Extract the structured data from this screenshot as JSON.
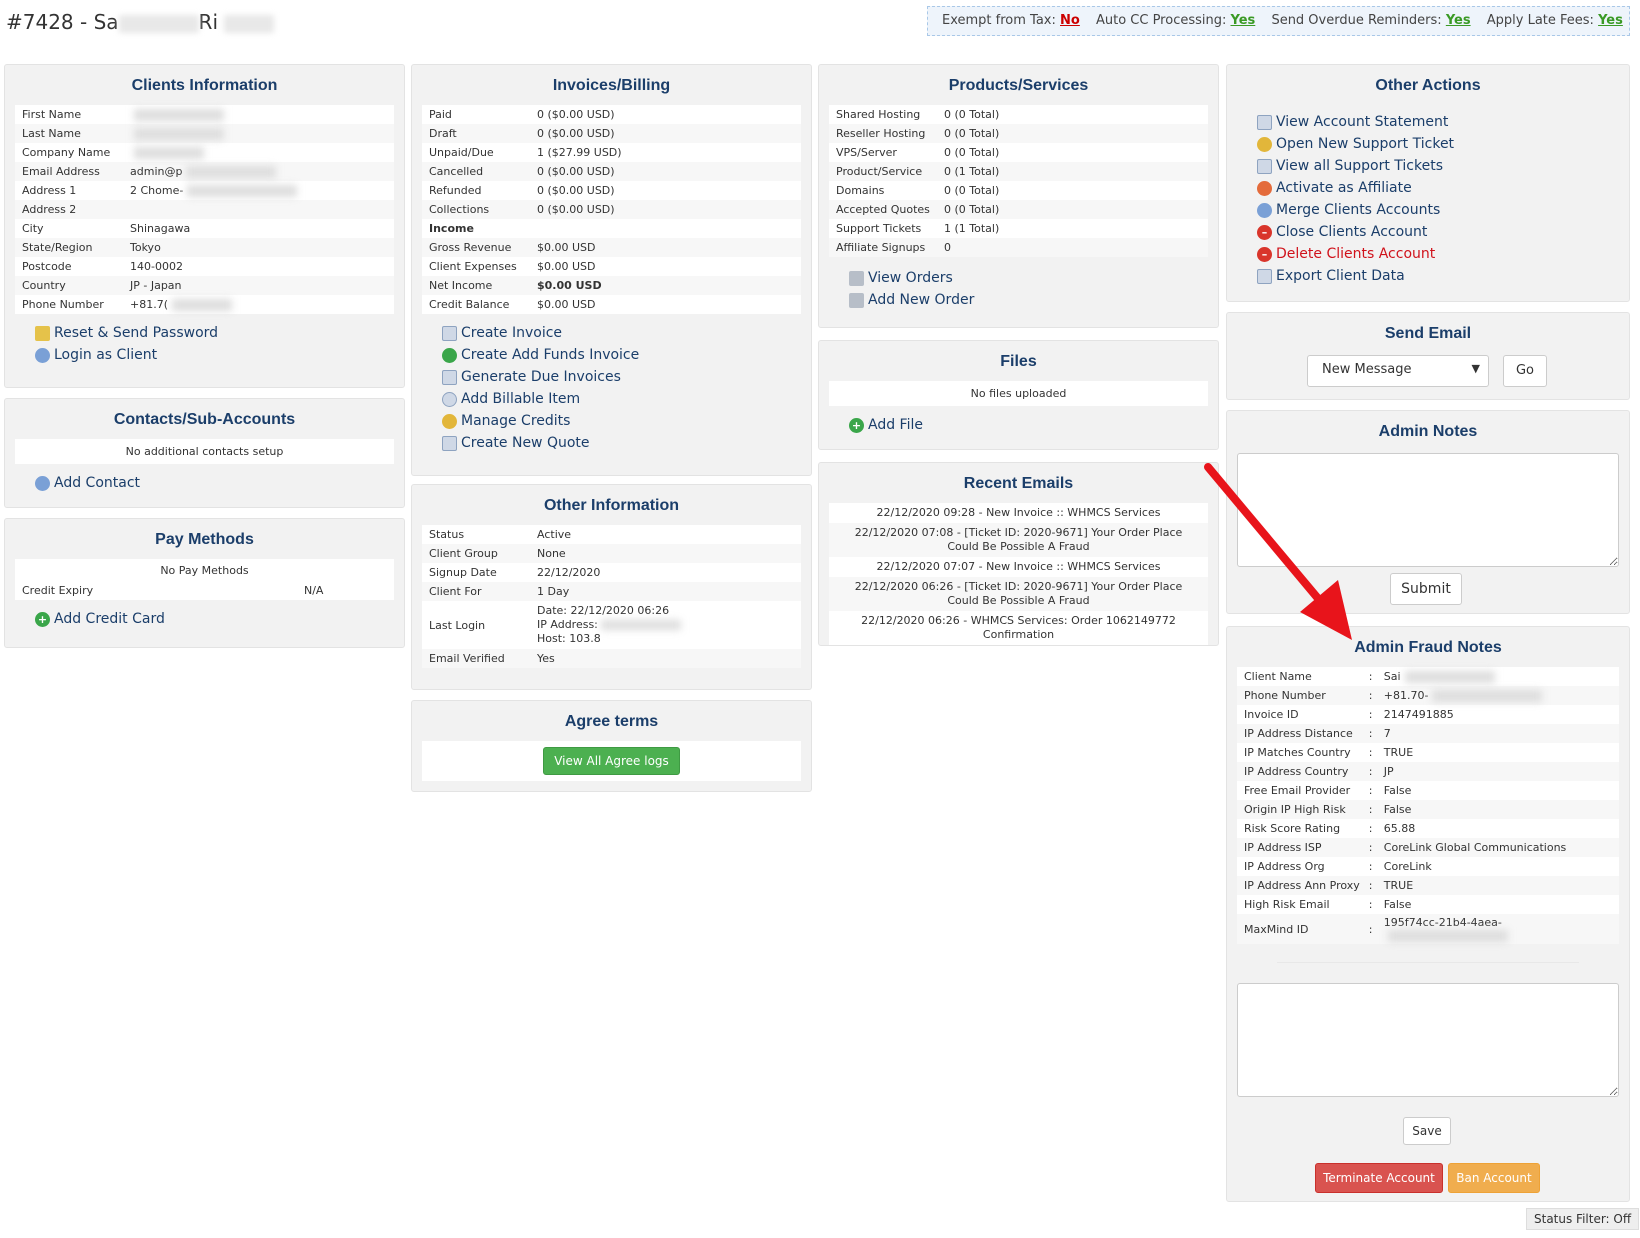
{
  "header": {
    "title_prefix": "#7428 - Sa",
    "title_mid": "Ri"
  },
  "taxbar": {
    "exempt_label": "Exempt from Tax:",
    "exempt_value": "No",
    "autocc_label": "Auto CC Processing:",
    "autocc_value": "Yes",
    "overdue_label": "Send Overdue Reminders:",
    "overdue_value": "Yes",
    "latefee_label": "Apply Late Fees:",
    "latefee_value": "Yes"
  },
  "clients_info": {
    "title": "Clients Information",
    "rows": [
      {
        "k": "First Name",
        "v": ""
      },
      {
        "k": "Last Name",
        "v": ""
      },
      {
        "k": "Company Name",
        "v": ""
      },
      {
        "k": "Email Address",
        "v": "admin@p"
      },
      {
        "k": "Address 1",
        "v": "2 Chome-"
      },
      {
        "k": "Address 2",
        "v": ""
      },
      {
        "k": "City",
        "v": "Shinagawa"
      },
      {
        "k": "State/Region",
        "v": "Tokyo"
      },
      {
        "k": "Postcode",
        "v": "140-0002"
      },
      {
        "k": "Country",
        "v": "JP - Japan"
      },
      {
        "k": "Phone Number",
        "v": "+81.7("
      }
    ],
    "links": [
      "Reset & Send Password",
      "Login as Client"
    ]
  },
  "contacts": {
    "title": "Contacts/Sub-Accounts",
    "note": "No additional contacts setup",
    "link": "Add Contact"
  },
  "paymethods": {
    "title": "Pay Methods",
    "note": "No Pay Methods",
    "expiry_label": "Credit Expiry",
    "expiry_value": "N/A",
    "link": "Add Credit Card"
  },
  "invoices": {
    "title": "Invoices/Billing",
    "rows": [
      {
        "k": "Paid",
        "v": "0 ($0.00 USD)"
      },
      {
        "k": "Draft",
        "v": "0 ($0.00 USD)"
      },
      {
        "k": "Unpaid/Due",
        "v": "1 ($27.99 USD)"
      },
      {
        "k": "Cancelled",
        "v": "0 ($0.00 USD)"
      },
      {
        "k": "Refunded",
        "v": "0 ($0.00 USD)"
      },
      {
        "k": "Collections",
        "v": "0 ($0.00 USD)"
      },
      {
        "k": "Income",
        "v": ""
      },
      {
        "k": "Gross Revenue",
        "v": "$0.00 USD"
      },
      {
        "k": "Client Expenses",
        "v": "$0.00 USD"
      },
      {
        "k": "Net Income",
        "v": "$0.00 USD"
      },
      {
        "k": "Credit Balance",
        "v": "$0.00 USD"
      }
    ],
    "links": [
      "Create Invoice",
      "Create Add Funds Invoice",
      "Generate Due Invoices",
      "Add Billable Item",
      "Manage Credits",
      "Create New Quote"
    ]
  },
  "other_info": {
    "title": "Other Information",
    "rows": [
      {
        "k": "Status",
        "v": "Active"
      },
      {
        "k": "Client Group",
        "v": "None"
      },
      {
        "k": "Signup Date",
        "v": "22/12/2020"
      },
      {
        "k": "Client For",
        "v": "1 Day"
      }
    ],
    "last_login_label": "Last Login",
    "last_login_lines": [
      "Date: 22/12/2020 06:26",
      "IP Address:",
      "Host: 103.8"
    ],
    "email_verified_label": "Email Verified",
    "email_verified_value": "Yes"
  },
  "agree": {
    "title": "Agree terms",
    "button": "View All Agree logs"
  },
  "products": {
    "title": "Products/Services",
    "rows": [
      {
        "k": "Shared Hosting",
        "v": "0 (0 Total)"
      },
      {
        "k": "Reseller Hosting",
        "v": "0 (0 Total)"
      },
      {
        "k": "VPS/Server",
        "v": "0 (0 Total)"
      },
      {
        "k": "Product/Service",
        "v": "0 (1 Total)"
      },
      {
        "k": "Domains",
        "v": "0 (0 Total)"
      },
      {
        "k": "Accepted Quotes",
        "v": "0 (0 Total)"
      },
      {
        "k": "Support Tickets",
        "v": "1 (1 Total)"
      },
      {
        "k": "Affiliate Signups",
        "v": "0"
      }
    ],
    "links": [
      "View Orders",
      "Add New Order"
    ]
  },
  "files": {
    "title": "Files",
    "note": "No files uploaded",
    "link": "Add File"
  },
  "emails": {
    "title": "Recent Emails",
    "rows": [
      "22/12/2020 09:28 - New Invoice :: WHMCS Services",
      "22/12/2020 07:08 - [Ticket ID: 2020-9671] Your Order Place Could Be Possible A Fraud",
      "22/12/2020 07:07 - New Invoice :: WHMCS Services",
      "22/12/2020 06:26 - [Ticket ID: 2020-9671] Your Order Place Could Be Possible A Fraud",
      "22/12/2020 06:26 - WHMCS Services: Order 1062149772 Confirmation"
    ]
  },
  "other_actions": {
    "title": "Other Actions",
    "links": [
      "View Account Statement",
      "Open New Support Ticket",
      "View all Support Tickets",
      "Activate as Affiliate",
      "Merge Clients Accounts",
      "Close Clients Account",
      "Delete Clients Account",
      "Export Client Data"
    ]
  },
  "send_email": {
    "title": "Send Email",
    "selected": "New Message",
    "go": "Go"
  },
  "admin_notes": {
    "title": "Admin Notes",
    "submit": "Submit"
  },
  "fraud": {
    "title": "Admin Fraud Notes",
    "rows": [
      {
        "k": "Client Name",
        "v": "Sai"
      },
      {
        "k": "Phone Number",
        "v": "+81.70-"
      },
      {
        "k": "Invoice ID",
        "v": "2147491885"
      },
      {
        "k": "IP Address Distance",
        "v": "7"
      },
      {
        "k": "IP Matches Country",
        "v": "TRUE"
      },
      {
        "k": "IP Address Country",
        "v": "JP"
      },
      {
        "k": "Free Email Provider",
        "v": "False"
      },
      {
        "k": "Origin IP High Risk",
        "v": "False"
      },
      {
        "k": "Risk Score Rating",
        "v": "65.88"
      },
      {
        "k": "IP Address ISP",
        "v": "CoreLink Global Communications"
      },
      {
        "k": "IP Address Org",
        "v": "CoreLink"
      },
      {
        "k": "IP Address Ann Proxy",
        "v": "TRUE"
      },
      {
        "k": "High Risk Email",
        "v": "False"
      },
      {
        "k": "MaxMind ID",
        "v": "195f74cc-21b4-4aea-"
      }
    ],
    "save": "Save",
    "terminate": "Terminate Account",
    "ban": "Ban Account"
  },
  "status_filter": "Status Filter: Off",
  "colors": {
    "heading": "#1b3e6a",
    "arrow": "#e8141b",
    "panel_bg": "#f2f2f2"
  }
}
